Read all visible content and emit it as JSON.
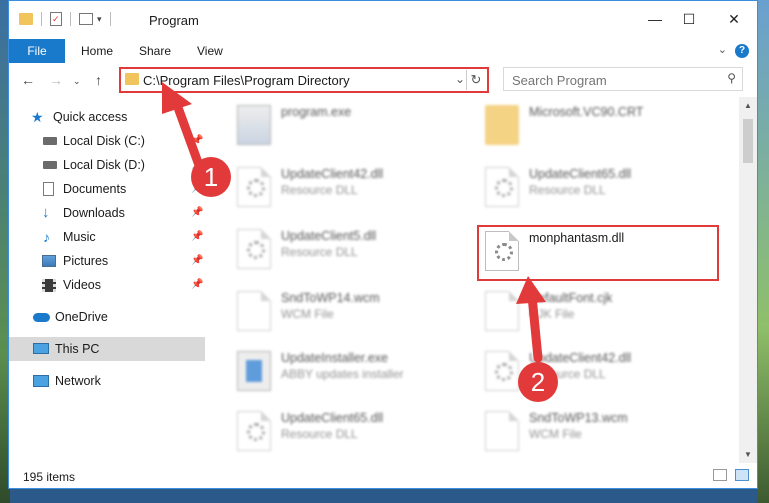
{
  "window": {
    "title": "Program"
  },
  "ribbon": {
    "tabs": [
      "File",
      "Home",
      "Share",
      "View"
    ],
    "help": "?"
  },
  "address": {
    "path": "C:\\Program Files\\Program Directory"
  },
  "search": {
    "placeholder": "Search Program"
  },
  "sidebar": {
    "items": [
      {
        "label": "Quick access"
      },
      {
        "label": "Local Disk (C:)"
      },
      {
        "label": "Local Disk (D:)"
      },
      {
        "label": "Documents"
      },
      {
        "label": "Downloads"
      },
      {
        "label": "Music"
      },
      {
        "label": "Pictures"
      },
      {
        "label": "Videos"
      },
      {
        "label": "OneDrive"
      },
      {
        "label": "This PC"
      },
      {
        "label": "Network"
      }
    ]
  },
  "files": [
    {
      "name": "program.exe",
      "type": ""
    },
    {
      "name": "Microsoft.VC90.CRT",
      "type": ""
    },
    {
      "name": "UpdateClient42.dll",
      "type": "Resource DLL"
    },
    {
      "name": "UpdateClient65.dll",
      "type": "Resource DLL"
    },
    {
      "name": "UpdateClient5.dll",
      "type": "Resource DLL"
    },
    {
      "name": "monphantasm.dll",
      "type": ""
    },
    {
      "name": "SndToWP14.wcm",
      "type": "WCM File"
    },
    {
      "name": "DefaultFont.cjk",
      "type": "CJK File"
    },
    {
      "name": "UpdateInstaller.exe",
      "type": "ABBY updates installer"
    },
    {
      "name": "UpdateClient42.dll",
      "type": "Resource DLL"
    },
    {
      "name": "UpdateClient65.dll",
      "type": "Resource DLL"
    },
    {
      "name": "SndToWP13.wcm",
      "type": "WCM File"
    }
  ],
  "status": {
    "count": "195 items"
  },
  "callouts": {
    "one": "1",
    "two": "2"
  },
  "colors": {
    "accent": "#1979ca",
    "highlight": "#e23a3a"
  }
}
